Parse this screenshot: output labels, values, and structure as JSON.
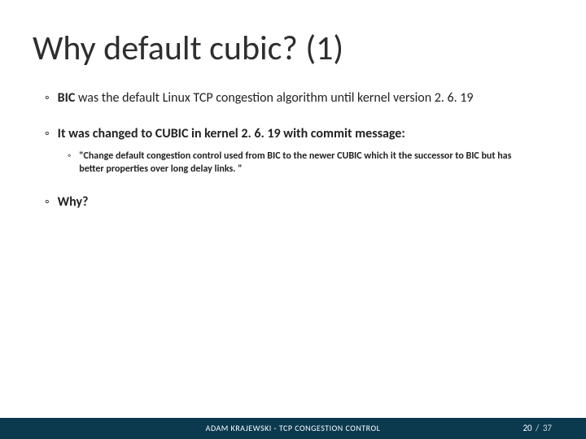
{
  "title": "Why default cubic? (1)",
  "bullets": {
    "b1": {
      "prefix": "BIC",
      "rest": " was the default Linux TCP congestion algorithm until kernel version 2. 6. 19"
    },
    "b2_intro": "It was changed to CUBIC in kernel 2. 6. 19 with commit message:",
    "b2_quote": "\"Change default congestion control used from BIC to the newer CUBIC which it the successor to BIC but has better properties over long delay links. \"",
    "b3": "Why?"
  },
  "bullet_char_l1": "◦",
  "bullet_char_l2": "◦",
  "footer": {
    "center": "ADAM KRAJEWSKI - TCP CONGESTION CONTROL",
    "page_current": "20",
    "page_sep": " / ",
    "page_total": "37"
  }
}
